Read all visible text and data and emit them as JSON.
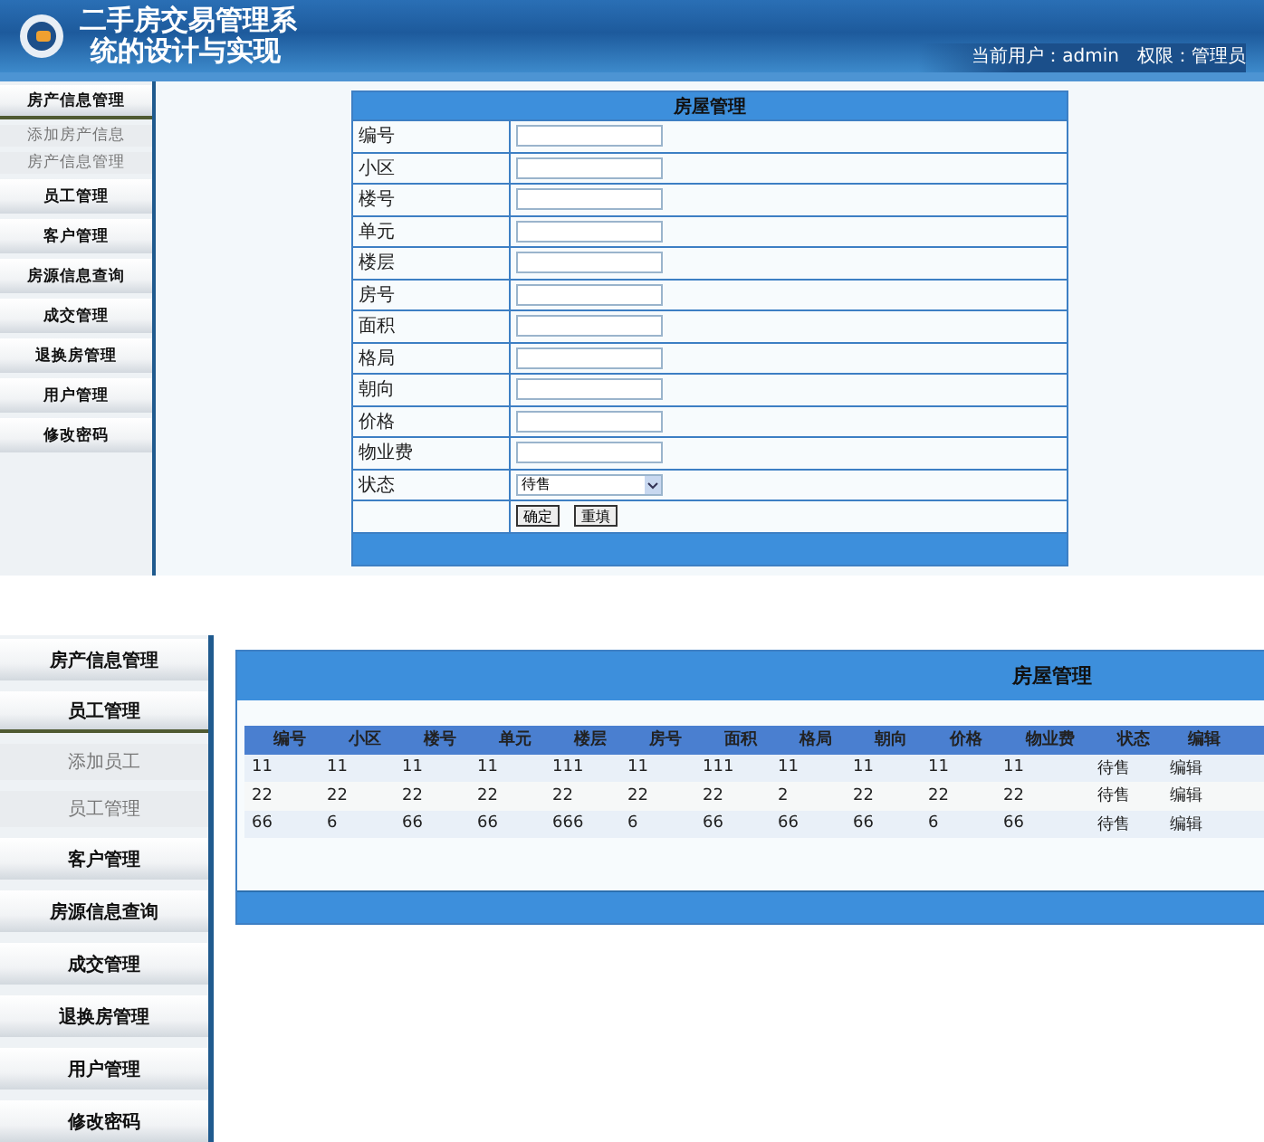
{
  "top": {
    "header": {
      "title_line1": "二手房交易管理系",
      "title_line2": "统的设计与实现",
      "user_info": "当前用户：admin　权限：管理员"
    },
    "sidebar": [
      {
        "label": "房产信息管理",
        "expanded": true,
        "children": [
          {
            "label": "添加房产信息"
          },
          {
            "label": "房产信息管理"
          }
        ]
      },
      {
        "label": "员工管理",
        "expanded": false
      },
      {
        "label": "客户管理",
        "expanded": false
      },
      {
        "label": "房源信息查询",
        "expanded": false
      },
      {
        "label": "成交管理",
        "expanded": false
      },
      {
        "label": "退换房管理",
        "expanded": false
      },
      {
        "label": "用户管理",
        "expanded": false
      },
      {
        "label": "修改密码",
        "expanded": false
      }
    ],
    "form": {
      "title": "房屋管理",
      "fields": [
        {
          "label": "编号",
          "kind": "text"
        },
        {
          "label": "小区",
          "kind": "text"
        },
        {
          "label": "楼号",
          "kind": "text"
        },
        {
          "label": "单元",
          "kind": "text"
        },
        {
          "label": "楼层",
          "kind": "text"
        },
        {
          "label": "房号",
          "kind": "text"
        },
        {
          "label": "面积",
          "kind": "text"
        },
        {
          "label": "格局",
          "kind": "text"
        },
        {
          "label": "朝向",
          "kind": "text"
        },
        {
          "label": "价格",
          "kind": "text"
        },
        {
          "label": "物业费",
          "kind": "text"
        },
        {
          "label": "状态",
          "kind": "select",
          "value": "待售"
        }
      ],
      "buttons": [
        "确定",
        "重填"
      ]
    }
  },
  "bottom": {
    "sidebar": [
      {
        "label": "房产信息管理",
        "expanded": false
      },
      {
        "label": "员工管理",
        "expanded": true,
        "children": [
          {
            "label": "添加员工"
          },
          {
            "label": "员工管理"
          }
        ]
      },
      {
        "label": "客户管理",
        "expanded": false
      },
      {
        "label": "房源信息查询",
        "expanded": false
      },
      {
        "label": "成交管理",
        "expanded": false
      },
      {
        "label": "退换房管理",
        "expanded": false
      },
      {
        "label": "用户管理",
        "expanded": false
      },
      {
        "label": "修改密码",
        "expanded": false
      }
    ],
    "table": {
      "title": "房屋管理",
      "columns": [
        "编号",
        "小区",
        "楼号",
        "单元",
        "楼层",
        "房号",
        "面积",
        "格局",
        "朝向",
        "价格",
        "物业费",
        "状态",
        "编辑"
      ],
      "rows": [
        [
          "11",
          "11",
          "11",
          "11",
          "111",
          "11",
          "111",
          "11",
          "11",
          "11",
          "11",
          "待售",
          "编辑"
        ],
        [
          "22",
          "22",
          "22",
          "22",
          "22",
          "22",
          "22",
          "2",
          "22",
          "22",
          "22",
          "待售",
          "编辑"
        ],
        [
          "66",
          "6",
          "66",
          "66",
          "666",
          "6",
          "66",
          "66",
          "66",
          "6",
          "66",
          "待售",
          "编辑"
        ]
      ]
    }
  }
}
